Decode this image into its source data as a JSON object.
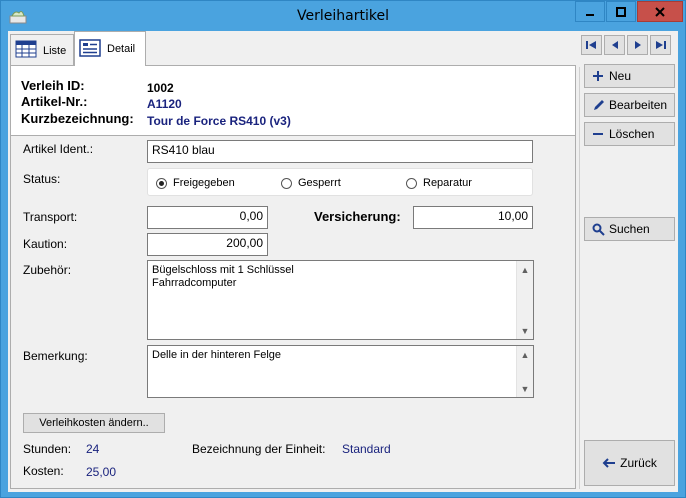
{
  "window": {
    "title": "Verleihartikel"
  },
  "tabs": [
    {
      "label": "Liste",
      "icon": "table-icon"
    },
    {
      "label": "Detail",
      "icon": "detail-form-icon"
    }
  ],
  "header": {
    "verleih_id_label": "Verleih ID:",
    "verleih_id_value": "1002",
    "artikel_nr_label": "Artikel-Nr.:",
    "artikel_nr_value": "A1120",
    "kurzbezeichnung_label": "Kurzbezeichnung:",
    "kurzbezeichnung_value": "Tour de Force RS410 (v3)"
  },
  "form": {
    "artikel_ident_label": "Artikel Ident.:",
    "artikel_ident_value": "RS410 blau",
    "status_label": "Status:",
    "status_options": [
      {
        "label": "Freigegeben",
        "selected": true
      },
      {
        "label": "Gesperrt",
        "selected": false
      },
      {
        "label": "Reparatur",
        "selected": false
      }
    ],
    "transport_label": "Transport:",
    "transport_value": "0,00",
    "versicherung_label": "Versicherung:",
    "versicherung_value": "10,00",
    "kaution_label": "Kaution:",
    "kaution_value": "200,00",
    "zubehoer_label": "Zubehör:",
    "zubehoer_lines": [
      "Bügelschloss mit 1 Schlüssel",
      "Fahrradcomputer"
    ],
    "bemerkung_label": "Bemerkung:",
    "bemerkung_lines": [
      "Delle in der hinteren Felge"
    ],
    "verleihkosten_button": "Verleihkosten ändern..",
    "stunden_label": "Stunden:",
    "stunden_value": "24",
    "einheit_label": "Bezeichnung der Einheit:",
    "einheit_value": "Standard",
    "kosten_label": "Kosten:",
    "kosten_value": "25,00"
  },
  "sidebar": {
    "neu": "Neu",
    "bearbeiten": "Bearbeiten",
    "loeschen": "Löschen",
    "suchen": "Suchen",
    "zurueck": "Zurück"
  },
  "colors": {
    "title_bar": "#4aa3df",
    "close_button": "#c7504a",
    "value_blue": "#1a237e"
  }
}
